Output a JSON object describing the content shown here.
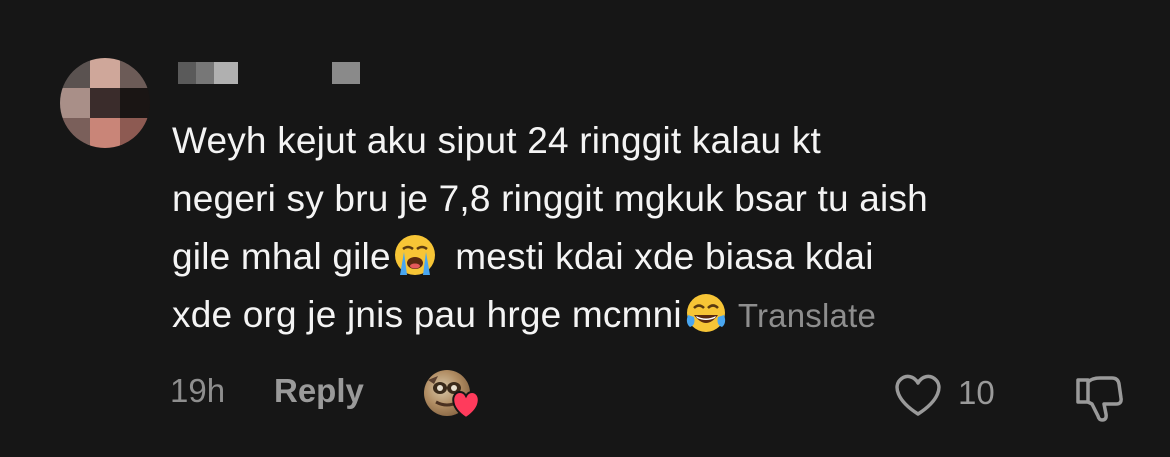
{
  "comment": {
    "lines": [
      "Weyh kejut aku siput 24 ringgit kalau kt",
      "negeri sy bru je 7,8 ringgit mgkuk bsar tu aish",
      "gile mhal gile",
      "mesti kdai xde biasa kdai",
      "xde org je jnis pau hrge mcmni"
    ],
    "translate_label": "Translate",
    "time": "19h",
    "reply_label": "Reply",
    "like_count": "10"
  },
  "colors": {
    "background": "#161616",
    "text": "#f4f4f4",
    "muted": "#8e8e8e",
    "heart": "#ff3b5c"
  },
  "icons": {
    "crying_emoji": "loudly-crying-face-icon",
    "laughing_emoji": "face-with-tears-of-joy-icon",
    "like": "heart-outline-icon",
    "dislike": "thumbs-down-icon",
    "creator_like_badge": "heart-icon"
  }
}
